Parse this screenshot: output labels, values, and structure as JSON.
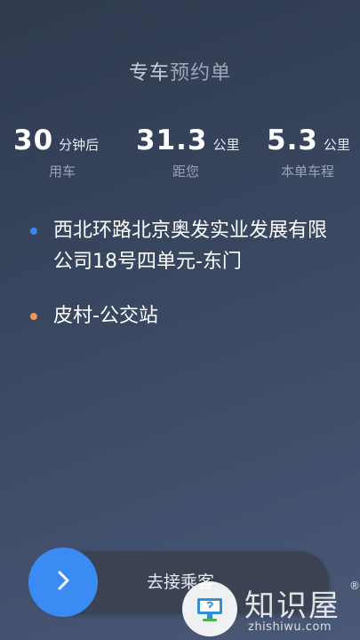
{
  "header": {
    "title_main": "专车",
    "title_rest": "预约单"
  },
  "stats": [
    {
      "value": "30",
      "unit": "分钟后",
      "label": "用车"
    },
    {
      "value": "31.3",
      "unit": "公里",
      "label": "距您"
    },
    {
      "value": "5.3",
      "unit": "公里",
      "label": "本单车程"
    }
  ],
  "route": {
    "pickup": "西北环路北京奥发实业发展有限公司18号四单元-东门",
    "dropoff": "皮村-公交站",
    "pickup_color": "#3e84ee",
    "dropoff_color": "#f0955a"
  },
  "action": {
    "label": "去接乘客",
    "icon": "chevron-right-icon",
    "accent": "#3a8bf4"
  },
  "watermark": {
    "cn": "知识屋",
    "reg": "®",
    "en": "zhishiwu.com"
  }
}
